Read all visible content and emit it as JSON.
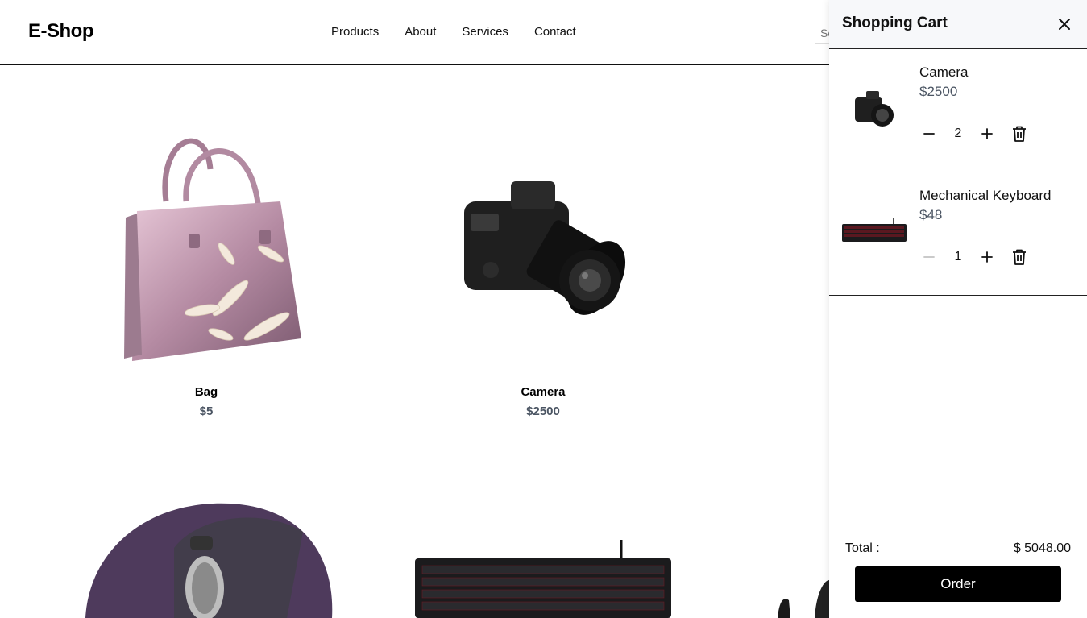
{
  "header": {
    "logo": "E-Shop",
    "nav": [
      "Products",
      "About",
      "Services",
      "Contact"
    ],
    "search_placeholder": "Search"
  },
  "products": [
    {
      "name": "Bag",
      "price": "$5"
    },
    {
      "name": "Camera",
      "price": "$2500"
    }
  ],
  "cart": {
    "title": "Shopping Cart",
    "items": [
      {
        "name": "Camera",
        "price": "$2500",
        "qty": "2"
      },
      {
        "name": "Mechanical Keyboard",
        "price": "$48",
        "qty": "1"
      }
    ],
    "total_label": "Total :",
    "total_value": "$ 5048.00",
    "order_label": "Order"
  },
  "colors": {
    "accent": "#000000",
    "price_gray": "#4b5563",
    "cart_header_bg": "#f7f8fa"
  }
}
